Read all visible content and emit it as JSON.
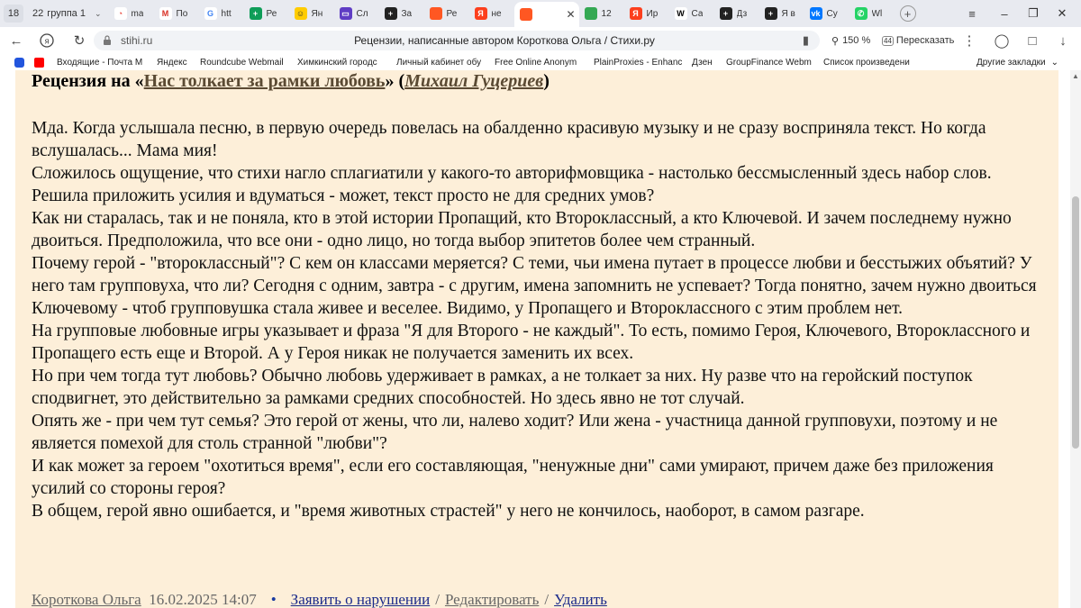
{
  "tabstrip": {
    "tab_count": "18",
    "group": {
      "count": "22",
      "label": "группа 1"
    },
    "tabs": [
      {
        "title": "ma",
        "color": "#ffffff",
        "glyph": "◔",
        "fg": "#e94235"
      },
      {
        "title": "По",
        "color": "#ffffff",
        "glyph": "M",
        "fg": "#d93025"
      },
      {
        "title": "htt",
        "color": "#ffffff",
        "glyph": "G",
        "fg": "#4285f4"
      },
      {
        "title": "Ре",
        "color": "#0f9d58",
        "glyph": "+",
        "fg": "#ffffff"
      },
      {
        "title": "Ян",
        "color": "#ffcc00",
        "glyph": "☺",
        "fg": "#333333"
      },
      {
        "title": "Сл",
        "color": "#5f3dc4",
        "glyph": "▭",
        "fg": "#ffffff"
      },
      {
        "title": "За",
        "color": "#222222",
        "glyph": "+",
        "fg": "#ffffff"
      },
      {
        "title": "Ре",
        "color": "#ff5722",
        "glyph": "",
        "fg": "#ffffff"
      },
      {
        "title": "не",
        "color": "#fc3f1d",
        "glyph": "Я",
        "fg": "#ffffff"
      },
      {
        "title": "",
        "color": "#ff5722",
        "glyph": "",
        "fg": "#ffffff",
        "active": true
      },
      {
        "title": "12",
        "color": "#34a853",
        "glyph": "",
        "fg": "#ffffff"
      },
      {
        "title": "Ир",
        "color": "#fc3f1d",
        "glyph": "Я",
        "fg": "#ffffff"
      },
      {
        "title": "Са",
        "color": "#ffffff",
        "glyph": "W",
        "fg": "#000000"
      },
      {
        "title": "Дз",
        "color": "#222222",
        "glyph": "+",
        "fg": "#ffffff"
      },
      {
        "title": "Я в",
        "color": "#222222",
        "glyph": "+",
        "fg": "#ffffff"
      },
      {
        "title": "Су",
        "color": "#0077ff",
        "glyph": "vk",
        "fg": "#ffffff"
      },
      {
        "title": "Wl",
        "color": "#25d366",
        "glyph": "✆",
        "fg": "#ffffff"
      }
    ]
  },
  "addressbar": {
    "url": "stihi.ru",
    "page_title": "Рецензии, написанные автором Короткова Ольга / Стихи.ру",
    "zoom": "150 %",
    "retell_label": "Пересказать",
    "retell_badge": "44"
  },
  "bookmarks": [
    {
      "label": "Входящие - Почта М",
      "color": "#ff0000"
    },
    {
      "label": "Яндекс",
      "color": "#ffffff"
    },
    {
      "label": "Roundcube Webmail",
      "color": "#ffffff"
    },
    {
      "label": "Химкинский городс",
      "color": "#ffffff"
    },
    {
      "label": "Личный кабинет обу",
      "color": "#ffffff"
    },
    {
      "label": "Free Online Anonym",
      "color": "#ffffff"
    },
    {
      "label": "PlainProxies - Enhanc",
      "color": "#ffffff"
    },
    {
      "label": "Дзен",
      "color": "#ffffff"
    },
    {
      "label": "GroupFinance Webm",
      "color": "#ffffff"
    },
    {
      "label": "Список произведени",
      "color": "#ffffff"
    }
  ],
  "other_bookmarks": "Другие закладки",
  "review": {
    "prefix": "Рецензия на «",
    "work_title": "Нас толкает за рамки любовь",
    "middle": "» (",
    "author": "Михаил Гуцериев",
    "suffix": ")",
    "paragraphs": [
      "Мда. Когда услышала песню, в первую очередь повелась на обалденно красивую музыку и не сразу восприняла текст. Но когда вслушалась... Мама мия!",
      "Сложилось ощущение, что стихи нагло сплагиатили у какого-то авторифмовщика - настолько бессмысленный здесь набор слов.",
      "Решила приложить усилия и вдуматься - может, текст просто не для средних умов?",
      "Как ни старалась, так и не поняла, кто в этой истории Пропащий, кто Второклассный, а кто Ключевой. И зачем последнему нужно двоиться. Предположила, что все они - одно лицо, но тогда выбор эпитетов более чем странный.",
      "Почему герой - \"второклассный\"? С кем он классами меряется? С теми, чьи имена путает в процессе любви и бесстыжих объятий? У него там групповуха, что ли? Сегодня с одним, завтра - с другим, имена запомнить не успевает? Тогда понятно, зачем нужно двоиться Ключевому - чтоб групповушка стала живее и веселее. Видимо, у Пропащего и Второклассного с этим проблем нет.",
      "На групповые любовные игры указывает и фраза \"Я для Второго - не каждый\". То есть, помимо Героя, Ключевого, Второклассного и Пропащего есть еще и Второй. А у Героя никак не получается заменить их всех.",
      "Но при чем тогда тут любовь? Обычно любовь удерживает в рамках, а не толкает за них. Ну разве что на геройский поступок сподвигнет, это действительно за рамками средних способностей. Но здесь явно не тот случай.",
      "Опять же - при чем тут семья? Это герой от жены, что ли, налево ходит? Или жена - участница данной групповухи, поэтому и не является помехой для столь странной \"любви\"?",
      "И как может за героем \"охотиться время\", если его составляющая, \"ненужные дни\" сами умирают, причем даже без приложения усилий со стороны героя?",
      "В общем, герой явно ошибается, и \"время животных страстей\" у него не кончилось, наоборот, в самом разгаре."
    ],
    "footer": {
      "author": "Короткова Ольга",
      "datetime": "16.02.2025 14:07",
      "bullet": "•",
      "report": "Заявить о нарушении",
      "sep1": "/",
      "edit": "Редактировать",
      "sep2": "/",
      "delete": "Удалить"
    }
  }
}
